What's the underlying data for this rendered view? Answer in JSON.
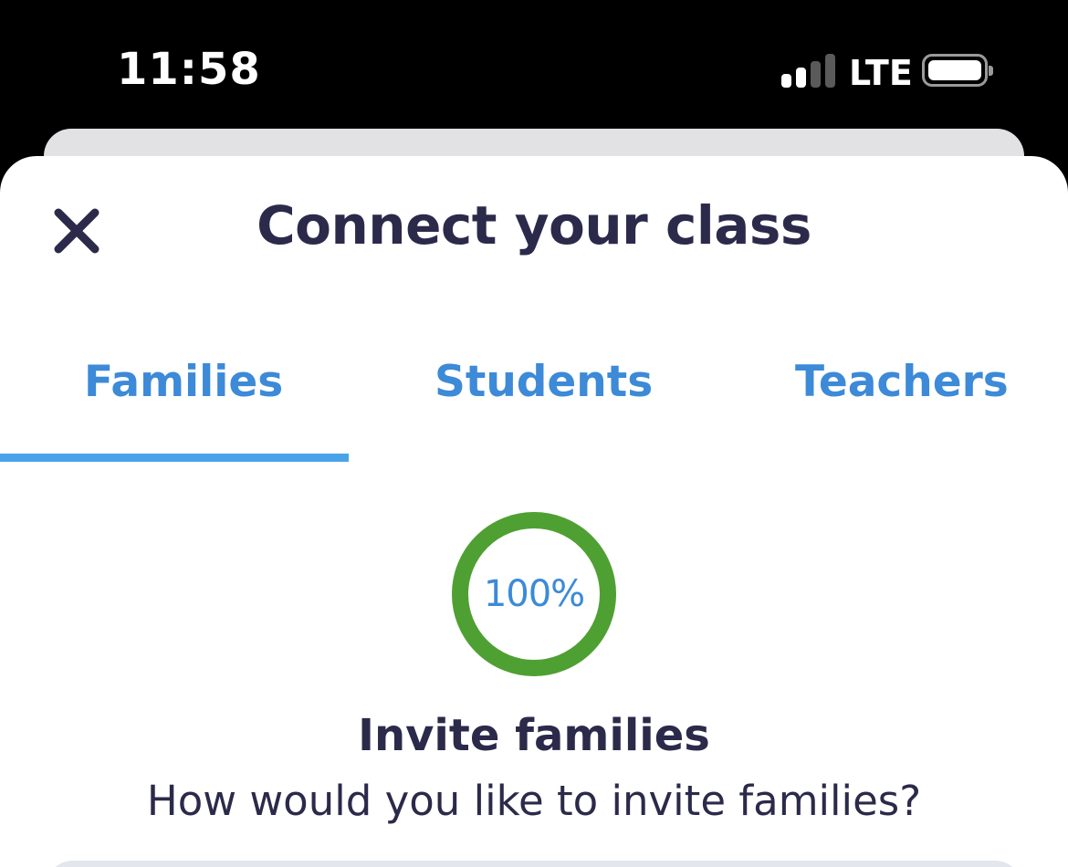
{
  "status_bar": {
    "time": "11:58",
    "network": "LTE",
    "signal_icon": "cellular-signal-icon",
    "signal_bars_active": 2,
    "signal_bars_total": 4,
    "battery_icon": "battery-icon",
    "battery_level": 1.0
  },
  "sheet": {
    "title": "Connect your class",
    "close_icon": "close-icon"
  },
  "tabs": {
    "selected": "families",
    "items": [
      {
        "id": "families",
        "label": "Families"
      },
      {
        "id": "students",
        "label": "Students"
      },
      {
        "id": "teachers",
        "label": "Teachers"
      }
    ]
  },
  "progress": {
    "value": 1.0,
    "label": "100%"
  },
  "invite": {
    "heading": "Invite families",
    "subtitle": "How would you like to invite families?"
  },
  "colors": {
    "title_text": "#2c2a4a",
    "tab_text": "#3c8ad8",
    "tab_indicator": "#4aa3e8",
    "progress_ring": "#4fa032",
    "background": "#ffffff"
  }
}
